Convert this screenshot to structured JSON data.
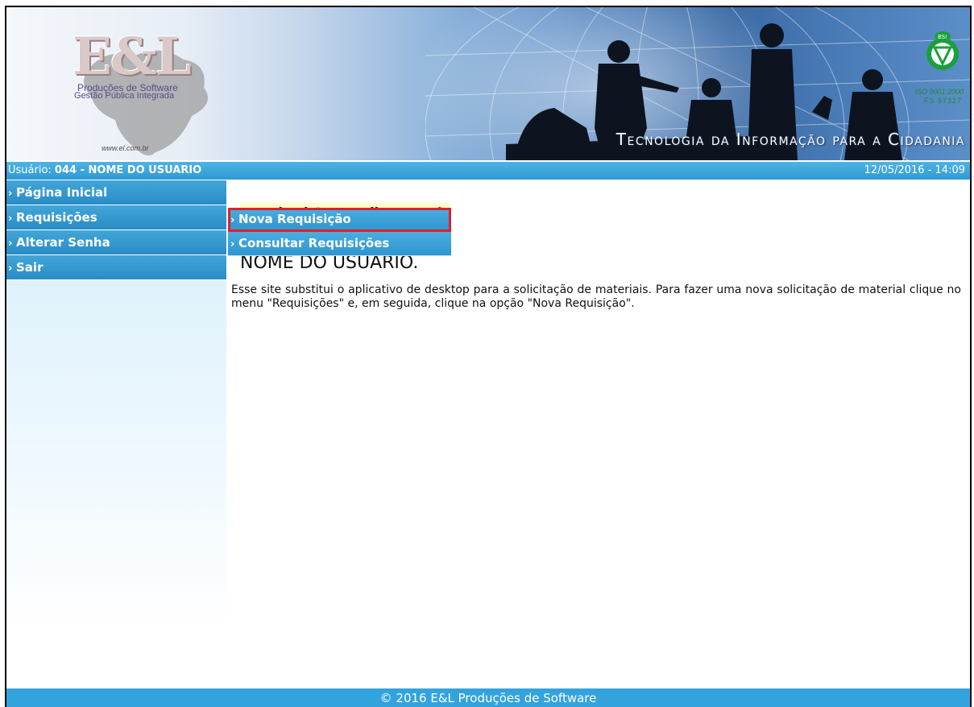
{
  "header": {
    "logo_text": "E&L",
    "logo_subtitle_1": "Produções de Software",
    "logo_subtitle_2": "Gestão Pública Integrada",
    "logo_url": "www.el.com.br",
    "slogan": "Tecnologia da Informação para a Cidadania",
    "cert_1": "ISO 9001:2000",
    "cert_2": "FS 97327",
    "cert_badge": "BSI"
  },
  "userbar": {
    "label": "Usuário: ",
    "user": "044 - NOME DO USUARIO",
    "datetime": "12/05/2016 - 14:09"
  },
  "sidebar": {
    "items": [
      {
        "label": "Página Inicial"
      },
      {
        "label": "Requisições"
      },
      {
        "label": "Alterar Senha"
      },
      {
        "label": "Sair"
      }
    ]
  },
  "dropdown": {
    "items": [
      {
        "label": "Nova Requisição"
      },
      {
        "label": "Consultar Requisições"
      }
    ]
  },
  "main": {
    "notice_text": "uso do sistema, clique ",
    "notice_link": "aqui",
    "notice_end": ".",
    "welcome": "NOME DO USUARIO.",
    "intro": "Esse site substitui o aplicativo de desktop para a solicitação de materiais. Para fazer uma nova solicitação de material clique no menu \"Requisições\" e, em seguida, clique na opção \"Nova Requisição\"."
  },
  "footer": {
    "text": "© 2016 E&L Produções de Software"
  },
  "colors": {
    "accent": "#2f9ad4",
    "highlight": "#e0202a",
    "link": "#e01010",
    "notice_bg": "#ffffc8"
  }
}
